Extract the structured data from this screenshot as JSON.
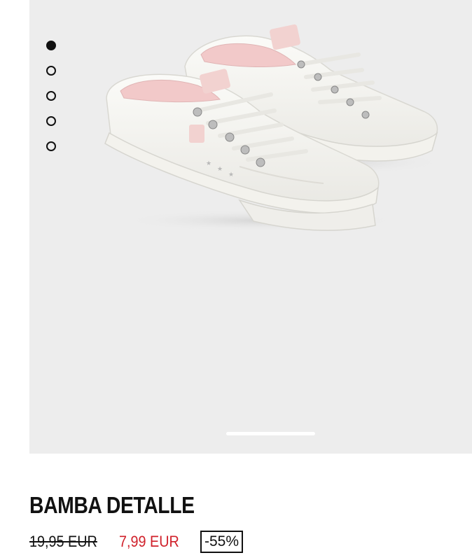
{
  "gallery": {
    "dots": [
      {
        "label": "image-1",
        "active": true
      },
      {
        "label": "image-2",
        "active": false
      },
      {
        "label": "image-3",
        "active": false
      },
      {
        "label": "image-4",
        "active": false
      },
      {
        "label": "image-5",
        "active": false
      }
    ]
  },
  "product": {
    "title": "BAMBA DETALLE",
    "price_original": "19,95 EUR",
    "price_sale": "7,99 EUR",
    "discount": "-55%"
  },
  "colors": {
    "sale_price": "#d0202a",
    "background_image": "#ededed",
    "text": "#111111"
  }
}
